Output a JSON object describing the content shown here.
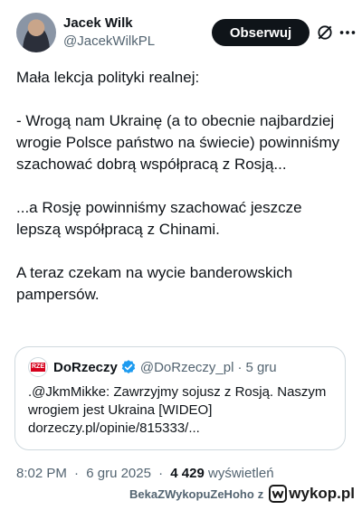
{
  "author": {
    "display_name": "Jacek Wilk",
    "handle": "@JacekWilkPL"
  },
  "header": {
    "follow_label": "Obserwuj",
    "grok_icon": "grok-icon",
    "more_icon": "more-icon"
  },
  "tweet": {
    "paragraphs": [
      "Mała lekcja polityki realnej:",
      "- Wrogą nam Ukrainę (a to obecnie najbardziej wrogie Polsce państwo na świecie) powinniśmy szachować dobrą współpracą z Rosją...",
      "...a Rosję powinniśmy szachować jeszcze lepszą współpracą z Chinami.",
      "A teraz czekam na wycie banderowskich pampersów."
    ]
  },
  "quote": {
    "avatar_text": "RZE",
    "name": "DoRzeczy",
    "verified_icon": "verified-badge-icon",
    "handle": "@DoRzeczy_pl",
    "dot": "·",
    "time": "5 gru",
    "text": ".@JkmMikke: Zawrzyjmy sojusz z Rosją. Naszym wrogiem jest Ukraina [WIDEO] dorzeczy.pl/opinie/815333/..."
  },
  "meta": {
    "time": "8:02 PM",
    "sep1": "·",
    "date": "6 gru 2025",
    "sep2": "·",
    "views_count": "4 429",
    "views_label": "wyświetleń"
  },
  "watermark": {
    "user": "BekaZWykopuZeHoho",
    "from": "z",
    "site": "wykop.pl"
  },
  "colors": {
    "follow_bg": "#0f1419",
    "verified": "#1d9bf0",
    "secondary_text": "#536471",
    "border": "#cfd9de"
  }
}
